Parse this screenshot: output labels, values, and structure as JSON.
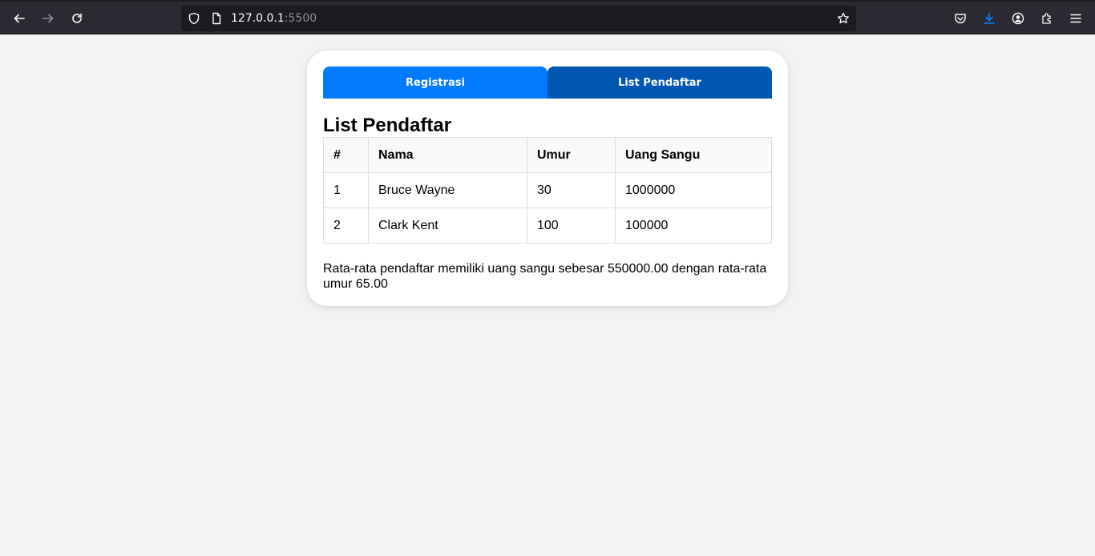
{
  "browser": {
    "url_host": "127.0.0.1",
    "url_port": ":5500"
  },
  "tabs": [
    {
      "label": "Registrasi"
    },
    {
      "label": "List Pendaftar"
    }
  ],
  "page": {
    "title": "List Pendaftar",
    "table": {
      "headers": [
        "#",
        "Nama",
        "Umur",
        "Uang Sangu"
      ],
      "rows": [
        [
          "1",
          "Bruce Wayne",
          "30",
          "1000000"
        ],
        [
          "2",
          "Clark Kent",
          "100",
          "100000"
        ]
      ]
    },
    "summary": "Rata-rata pendaftar memiliki uang sangu sebesar 550000.00 dengan rata-rata umur 65.00"
  },
  "colors": {
    "tab_active": "#0056b3",
    "tab_inactive": "#007bff",
    "page_bg": "#f3f3f3"
  }
}
